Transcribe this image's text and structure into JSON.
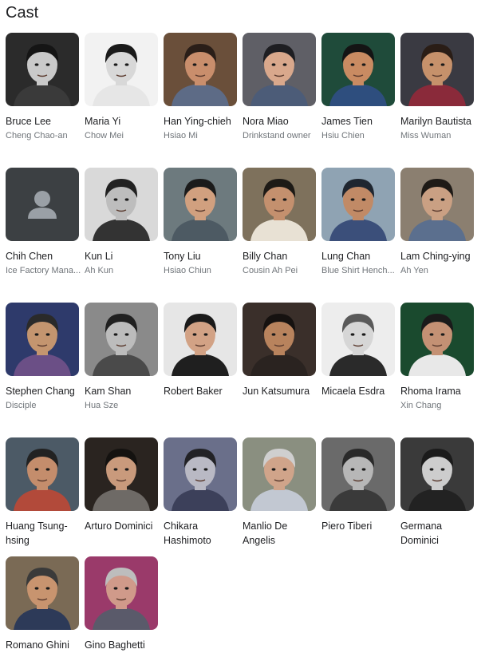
{
  "header": {
    "title": "Cast"
  },
  "cast": [
    {
      "name": "Bruce Lee",
      "role": "Cheng Chao-an",
      "skin": "#c9c9c9",
      "bg": "#2b2b2b",
      "hair": "#151515",
      "shirt": "#3a3a3a"
    },
    {
      "name": "Maria Yi",
      "role": "Chow Mei",
      "skin": "#d8d8d8",
      "bg": "#f2f2f2",
      "hair": "#1a1a1a",
      "shirt": "#e6e6e6"
    },
    {
      "name": "Han Ying-chieh",
      "role": "Hsiao Mi",
      "skin": "#c98e6c",
      "bg": "#6a4f3a",
      "hair": "#2a1e18",
      "shirt": "#5d6b86"
    },
    {
      "name": "Nora Miao",
      "role": "Drinkstand owner",
      "skin": "#d9a88c",
      "bg": "#5f5f66",
      "hair": "#1e1e22",
      "shirt": "#4c5c78"
    },
    {
      "name": "James Tien",
      "role": "Hsiu Chien",
      "skin": "#c98b62",
      "bg": "#1f4b3a",
      "hair": "#141414",
      "shirt": "#2e4e7e"
    },
    {
      "name": "Marilyn Bautista",
      "role": "Miss Wuman",
      "skin": "#c6916b",
      "bg": "#3a3a42",
      "hair": "#2a1d16",
      "shirt": "#8a2a3a"
    },
    {
      "name": "Chih Chen",
      "role": "Ice Factory Mana...",
      "placeholder": true
    },
    {
      "name": "Kun Li",
      "role": "Ah Kun",
      "skin": "#bdbdbd",
      "bg": "#d9d9d9",
      "hair": "#222222",
      "shirt": "#333333"
    },
    {
      "name": "Tony Liu",
      "role": "Hsiao Chiun",
      "skin": "#d1a07f",
      "bg": "#6d7a7e",
      "hair": "#1b1b1b",
      "shirt": "#4d5a63"
    },
    {
      "name": "Billy Chan",
      "role": "Cousin Ah Pei",
      "skin": "#c4906e",
      "bg": "#7e715c",
      "hair": "#1d1a16",
      "shirt": "#e8e1d4"
    },
    {
      "name": "Lung Chan",
      "role": "Blue Shirt Hench...",
      "skin": "#c18a66",
      "bg": "#8fa3b3",
      "hair": "#1f2630",
      "shirt": "#3b4f7a"
    },
    {
      "name": "Lam Ching-ying",
      "role": "Ah Yen",
      "skin": "#caa083",
      "bg": "#8b7f70",
      "hair": "#1e1a16",
      "shirt": "#5b6f8e"
    },
    {
      "name": "Stephen Chang",
      "role": "Disciple",
      "skin": "#c4956f",
      "bg": "#2e3a6b",
      "hair": "#2a2a2a",
      "shirt": "#6b4f86"
    },
    {
      "name": "Kam Shan",
      "role": "Hua Sze",
      "skin": "#bcbcbc",
      "bg": "#8a8a8a",
      "hair": "#202020",
      "shirt": "#4a4a4a"
    },
    {
      "name": "Robert Baker",
      "role": "",
      "skin": "#d2a285",
      "bg": "#e6e6e6",
      "hair": "#1a1a1a",
      "shirt": "#1f1f1f"
    },
    {
      "name": "Jun Katsumura",
      "role": "",
      "skin": "#b8835d",
      "bg": "#3a2f2a",
      "hair": "#161210",
      "shirt": "#2a2320"
    },
    {
      "name": "Micaela Esdra",
      "role": "",
      "skin": "#d6d6d6",
      "bg": "#ededed",
      "hair": "#5a5a5a",
      "shirt": "#2a2a2a"
    },
    {
      "name": "Rhoma Irama",
      "role": "Xin Chang",
      "skin": "#c49174",
      "bg": "#1a4a2e",
      "hair": "#1a1a1a",
      "shirt": "#e8e8e8"
    },
    {
      "name": "Huang Tsung-hsing",
      "role": "",
      "skin": "#c48d6c",
      "bg": "#4c5a66",
      "hair": "#222",
      "shirt": "#b24a3a"
    },
    {
      "name": "Arturo Dominici",
      "role": "",
      "skin": "#c99a7c",
      "bg": "#2a2420",
      "hair": "#141210",
      "shirt": "#6e6a66"
    },
    {
      "name": "Chikara Hashimoto",
      "role": "",
      "skin": "#b9b9c4",
      "bg": "#6a6f8a",
      "hair": "#222226",
      "shirt": "#3c405a"
    },
    {
      "name": "Manlio De Angelis",
      "role": "",
      "skin": "#d0a48a",
      "bg": "#8a8f80",
      "hair": "#cfcfcf",
      "shirt": "#c2c8d2"
    },
    {
      "name": "Piero Tiberi",
      "role": "",
      "skin": "#b7b7b7",
      "bg": "#6a6a6a",
      "hair": "#2a2a2a",
      "shirt": "#3a3a3a"
    },
    {
      "name": "Germana Dominici",
      "role": "",
      "skin": "#cdcdcd",
      "bg": "#3a3a3a",
      "hair": "#1b1b1b",
      "shirt": "#222"
    },
    {
      "name": "Romano Ghini",
      "role": "",
      "skin": "#c8946f",
      "bg": "#7a6a55",
      "hair": "#3a3a3a",
      "shirt": "#2d3a58"
    },
    {
      "name": "Gino Baghetti",
      "role": "",
      "skin": "#d09a8a",
      "bg": "#9a3a6a",
      "hair": "#bdbdbd",
      "shirt": "#5a5a6a"
    }
  ]
}
